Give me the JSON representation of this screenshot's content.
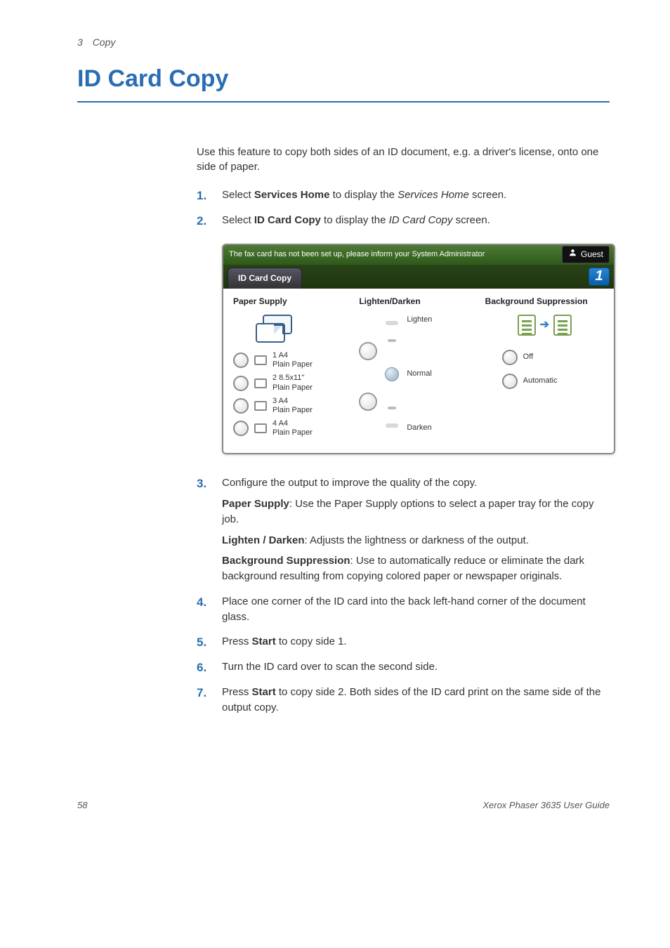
{
  "runningHead": {
    "chapter": "3",
    "section": "Copy"
  },
  "title": "ID Card Copy",
  "intro": "Use this feature to copy both sides of an ID document, e.g. a driver's license, onto one side of paper.",
  "steps": {
    "s1": {
      "pre": "Select ",
      "bold": "Services Home",
      "mid": " to display the ",
      "ital": "Services Home",
      "post": " screen."
    },
    "s2": {
      "pre": "Select ",
      "bold": "ID Card Copy",
      "mid": " to display the ",
      "ital": "ID Card Copy",
      "post": " screen."
    },
    "s3": {
      "main": "Configure the output to improve the quality of the copy.",
      "paperSupply": {
        "label": "Paper Supply",
        "text": ": Use the Paper Supply options to select a paper tray for the copy job."
      },
      "lightenDarken": {
        "label": "Lighten / Darken",
        "text": ": Adjusts the lightness or darkness of the output."
      },
      "bgSuppress": {
        "label": "Background Suppression",
        "text": ": Use to automatically reduce or eliminate the dark background resulting from copying colored paper or newspaper originals."
      }
    },
    "s4": "Place one corner of the ID card into the back left-hand corner of the document glass.",
    "s5": {
      "pre": "Press ",
      "bold": "Start",
      "post": " to copy side 1."
    },
    "s6": "Turn the ID card over to scan the second side.",
    "s7": {
      "pre": "Press ",
      "bold": "Start",
      "post": " to copy side 2. Both sides of the ID card print on the same side of the output copy."
    }
  },
  "ui": {
    "statusMessage": "The fax card has not been set up, please inform your System Administrator",
    "guest": "Guest",
    "tab": "ID Card Copy",
    "quantity": "1",
    "paperSupply": {
      "heading": "Paper Supply",
      "options": [
        {
          "line1": "1  A4",
          "line2": "Plain Paper"
        },
        {
          "line1": "2  8.5x11\"",
          "line2": "Plain Paper"
        },
        {
          "line1": "3  A4",
          "line2": "Plain Paper"
        },
        {
          "line1": "4  A4",
          "line2": "Plain Paper"
        }
      ]
    },
    "lightenDarken": {
      "heading": "Lighten/Darken",
      "lighten": "Lighten",
      "normal": "Normal",
      "darken": "Darken"
    },
    "bgSuppress": {
      "heading": "Background Suppression",
      "off": "Off",
      "auto": "Automatic"
    }
  },
  "footer": {
    "pageNum": "58",
    "bookTitle": "Xerox Phaser 3635 User Guide"
  }
}
